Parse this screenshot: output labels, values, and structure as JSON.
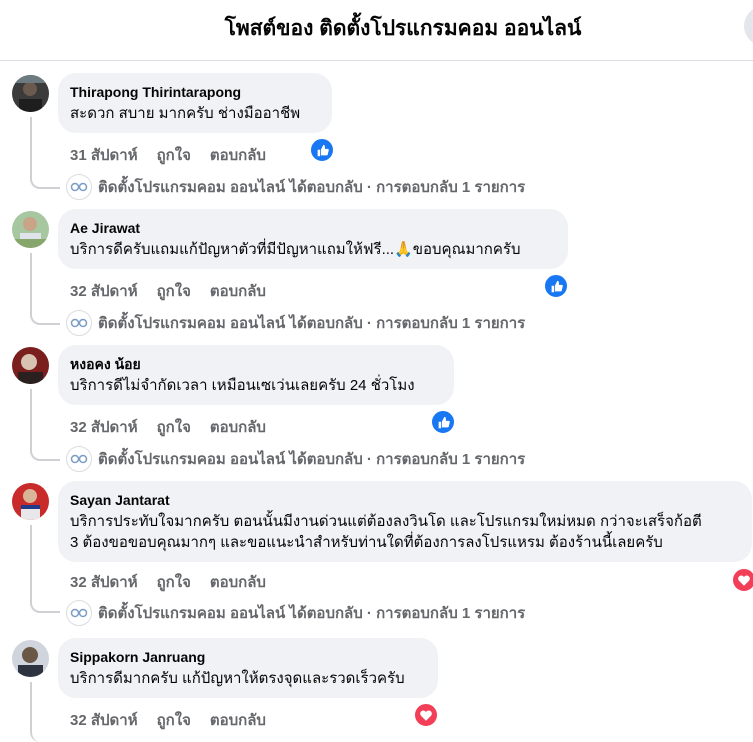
{
  "header": {
    "title": "โพสต์ของ ติดตั้งโปรแกรมคอม ออนไลน์"
  },
  "comments": [
    {
      "author": "Thirapong Thirintarapong",
      "text": "สะดวก สบาย มากครับ ช่างมืออาชีพ",
      "time": "31 สัปดาห์",
      "like_label": "ถูกใจ",
      "reply_label": "ตอบกลับ",
      "reaction": "like-icon",
      "replies_summary": "ติดตั้งโปรแกรมคอม ออนไลน์ ได้ตอบกลับ · การตอบกลับ 1 รายการ"
    },
    {
      "author": "Ae Jirawat",
      "text": "บริการดีครับแถมแก้ปัญหาตัวที่มีปัญหาแถมให้ฟรี...🙏ขอบคุณมากครับ",
      "time": "32 สัปดาห์",
      "like_label": "ถูกใจ",
      "reply_label": "ตอบกลับ",
      "reaction": "like-icon",
      "replies_summary": "ติดตั้งโปรแกรมคอม ออนไลน์ ได้ตอบกลับ · การตอบกลับ 1 รายการ"
    },
    {
      "author": "หงอคง น้อย",
      "text": "บริการดีไม่จำกัดเวลา เหมือนเซเว่นเลยครับ 24 ชั่วโมง",
      "time": "32 สัปดาห์",
      "like_label": "ถูกใจ",
      "reply_label": "ตอบกลับ",
      "reaction": "like-icon",
      "replies_summary": "ติดตั้งโปรแกรมคอม ออนไลน์ ได้ตอบกลับ · การตอบกลับ 1 รายการ"
    },
    {
      "author": "Sayan Jantarat",
      "text_line1": "บริการประทับใจมากครับ ตอนนั้นมีงานด่วนแต่ต้องลงวินโด และโปรแกรมใหม่หมด กว่าจะเสร็จก้อตี",
      "text_line2": "3 ต้องขอขอบคุณมากๆ และขอแนะนำสำหรับท่านใดที่ต้องการลงโปรแหรม ต้องร้านนี้เลยครับ",
      "time": "32 สัปดาห์",
      "like_label": "ถูกใจ",
      "reply_label": "ตอบกลับ",
      "reaction": "love-icon",
      "replies_summary": "ติดตั้งโปรแกรมคอม ออนไลน์ ได้ตอบกลับ · การตอบกลับ 1 รายการ"
    },
    {
      "author": "Sippakorn Janruang",
      "text": "บริการดีมากครับ แก้ปัญหาให้ตรงจุดและรวดเร็วครับ",
      "time": "32 สัปดาห์",
      "like_label": "ถูกใจ",
      "reply_label": "ตอบกลับ",
      "reaction": "love-icon"
    }
  ],
  "colors": {
    "like": "#1877f2",
    "love": "#f33e58",
    "bubble": "#f0f2f5",
    "muted": "#65676b"
  }
}
